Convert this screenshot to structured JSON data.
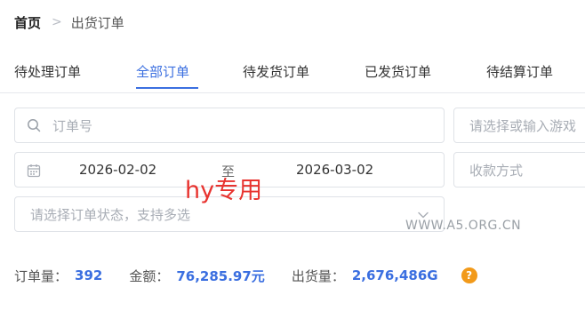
{
  "breadcrumb": {
    "home": "首页",
    "separator": ">",
    "current": "出货订单"
  },
  "tabs": [
    {
      "label": "待处理订单",
      "active": false
    },
    {
      "label": "全部订单",
      "active": true
    },
    {
      "label": "待发货订单",
      "active": false
    },
    {
      "label": "已发货订单",
      "active": false
    },
    {
      "label": "待结算订单",
      "active": false
    }
  ],
  "filters": {
    "order_search": {
      "placeholder": "订单号",
      "icon": "search-icon"
    },
    "game_select": {
      "placeholder": "请选择或输入游戏"
    },
    "date_range": {
      "start": "2026-02-02",
      "separator": "至",
      "end": "2026-03-02",
      "icon": "calendar-icon"
    },
    "payment_select": {
      "placeholder": "收款方式"
    },
    "status_select": {
      "placeholder": "请选择订单状态，支持多选",
      "icon": "chevron-down-icon"
    }
  },
  "watermarks": {
    "overlay": "hy专用",
    "site": "WWW.A5.ORG.CN"
  },
  "stats": {
    "order_count_label": "订单量：",
    "order_count": "392",
    "amount_label": "金额：",
    "amount": "76,285.97元",
    "shipped_label": "出货量：",
    "shipped": "2,676,486G",
    "help_icon": "?"
  },
  "colors": {
    "accent": "#3b6fe0",
    "help_badge": "#f29a1a",
    "watermark_red": "#e8332f"
  }
}
